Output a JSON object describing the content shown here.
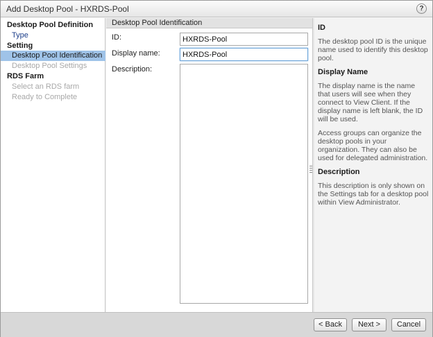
{
  "window": {
    "title": "Add Desktop Pool - HXRDS-Pool",
    "help_label": "?"
  },
  "nav": {
    "sections": [
      {
        "label": "Desktop Pool Definition"
      },
      {
        "label": "Setting"
      },
      {
        "label": "RDS Farm"
      }
    ],
    "items": [
      {
        "label": "Type",
        "state": "done"
      },
      {
        "label": "Desktop Pool Identification",
        "state": "active"
      },
      {
        "label": "Desktop Pool Settings",
        "state": "disabled"
      },
      {
        "label": "Select an RDS farm",
        "state": "disabled"
      },
      {
        "label": "Ready to Complete",
        "state": "disabled"
      }
    ]
  },
  "form": {
    "heading": "Desktop Pool Identification",
    "id_label": "ID:",
    "id_value": "HXRDS-Pool",
    "display_name_label": "Display name:",
    "display_name_value": "HXRDS-Pool",
    "description_label": "Description:",
    "description_value": ""
  },
  "help": {
    "id_title": "ID",
    "id_text": "The desktop pool ID is the unique name used to identify this desktop pool.",
    "display_title": "Display Name",
    "display_text": "The display name is the name that users will see when they connect to View Client. If the display name is left blank, the ID will be used.",
    "access_text": "Access groups can organize the desktop pools in your organization. They can also be used for delegated administration.",
    "description_title": "Description",
    "description_text": "This description is only shown on the Settings tab for a desktop pool within View Administrator."
  },
  "footer": {
    "back_label": "< Back",
    "next_label": "Next >",
    "cancel_label": "Cancel"
  }
}
